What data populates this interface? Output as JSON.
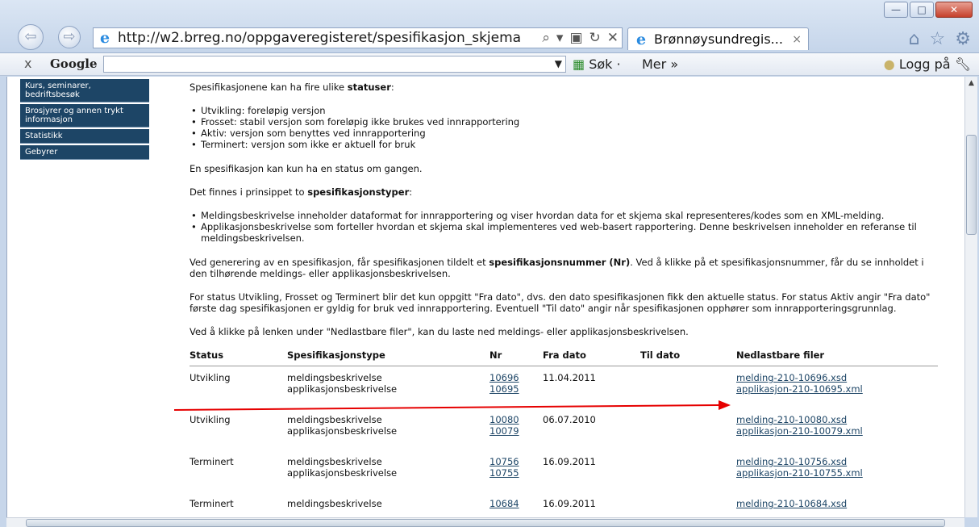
{
  "browser": {
    "url": "http://w2.brreg.no/oppgaveregisteret/spesifikasjon_skjema",
    "tab_title": "Brønnøysundregis...",
    "tab_close": "×",
    "minimize": "—",
    "maximize": "□",
    "close": "✕",
    "back_glyph": "⇦",
    "forward_glyph": "⇨",
    "home_icon": "⌂",
    "favorites_icon": "☆",
    "tools_icon": "⚙"
  },
  "google_toolbar": {
    "close": "x",
    "logo": "Google",
    "search_dropdown": "▼",
    "search_label": "Søk ·",
    "more_label": "Mer »",
    "login_label": "Logg på"
  },
  "sidebar": {
    "items": [
      {
        "label": "Kurs, seminarer, bedriftsbesøk"
      },
      {
        "label": "Brosjyrer og annen trykt informasjon"
      },
      {
        "label": "Statistikk"
      },
      {
        "label": "Gebyrer"
      }
    ]
  },
  "content": {
    "status_intro_pre": "Spesifikasjonene kan ha fire ulike ",
    "status_intro_bold": "statuser",
    "status_intro_post": ":",
    "statuses": [
      "Utvikling: foreløpig versjon",
      "Frosset: stabil versjon som foreløpig ikke brukes ved innrapportering",
      "Aktiv: versjon som benyttes ved innrapportering",
      "Terminert: versjon som ikke er aktuell for bruk"
    ],
    "one_status": "En spesifikasjon kan kun ha en status om gangen.",
    "types_intro_pre": "Det finnes i prinsippet to ",
    "types_intro_bold": "spesifikasjonstyper",
    "types_intro_post": ":",
    "types": [
      "Meldingsbeskrivelse inneholder dataformat for innrapportering og viser hvordan data for et skjema skal representeres/kodes som en XML-melding.",
      "Applikasjonsbeskrivelse som forteller hvordan et skjema skal implementeres ved web-basert rapportering. Denne beskrivelsen inneholder en referanse til meldingsbeskrivelsen."
    ],
    "nr_pre": "Ved generering av en spesifikasjon, får spesifikasjonen tildelt et ",
    "nr_bold": "spesifikasjonsnummer (Nr)",
    "nr_post": ". Ved å klikke på et spesifikasjonsnummer, får du se innholdet i den tilhørende meldings- eller applikasjonsbeskrivelsen.",
    "dates_text": "For status Utvikling, Frosset og Terminert blir det kun oppgitt \"Fra dato\", dvs. den dato spesifikasjonen fikk den aktuelle status. For status Aktiv angir \"Fra dato\" første dag spesifikasjonen er gyldig for bruk ved innrapportering. Eventuell \"Til dato\" angir når spesifikasjonen opphører som innrapporteringsgrunnlag.",
    "download_text": "Ved å klikke på lenken under \"Nedlastbare filer\", kan du laste ned meldings- eller applikasjonsbeskrivelsen."
  },
  "table": {
    "headers": [
      "Status",
      "Spesifikasjonstype",
      "Nr",
      "Fra dato",
      "Til dato",
      "Nedlastbare filer"
    ],
    "rows": [
      {
        "status": "Utvikling",
        "type1": "meldingsbeskrivelse",
        "type2": "applikasjonsbeskrivelse",
        "nr1": "10696",
        "nr2": "10695",
        "fra": "11.04.2011",
        "til": "",
        "file1": "melding-210-10696.xsd",
        "file2": "applikasjon-210-10695.xml"
      },
      {
        "status": "Utvikling",
        "type1": "meldingsbeskrivelse",
        "type2": "applikasjonsbeskrivelse",
        "nr1": "10080",
        "nr2": "10079",
        "fra": "06.07.2010",
        "til": "",
        "file1": "melding-210-10080.xsd",
        "file2": "applikasjon-210-10079.xml"
      },
      {
        "status": "Terminert",
        "type1": "meldingsbeskrivelse",
        "type2": "applikasjonsbeskrivelse",
        "nr1": "10756",
        "nr2": "10755",
        "fra": "16.09.2011",
        "til": "",
        "file1": "melding-210-10756.xsd",
        "file2": "applikasjon-210-10755.xml"
      },
      {
        "status": "Terminert",
        "type1": "meldingsbeskrivelse",
        "type2": "",
        "nr1": "10684",
        "nr2": "",
        "fra": "16.09.2011",
        "til": "",
        "file1": "melding-210-10684.xsd",
        "file2": ""
      }
    ]
  },
  "annotation": {
    "color": "#e60000"
  }
}
